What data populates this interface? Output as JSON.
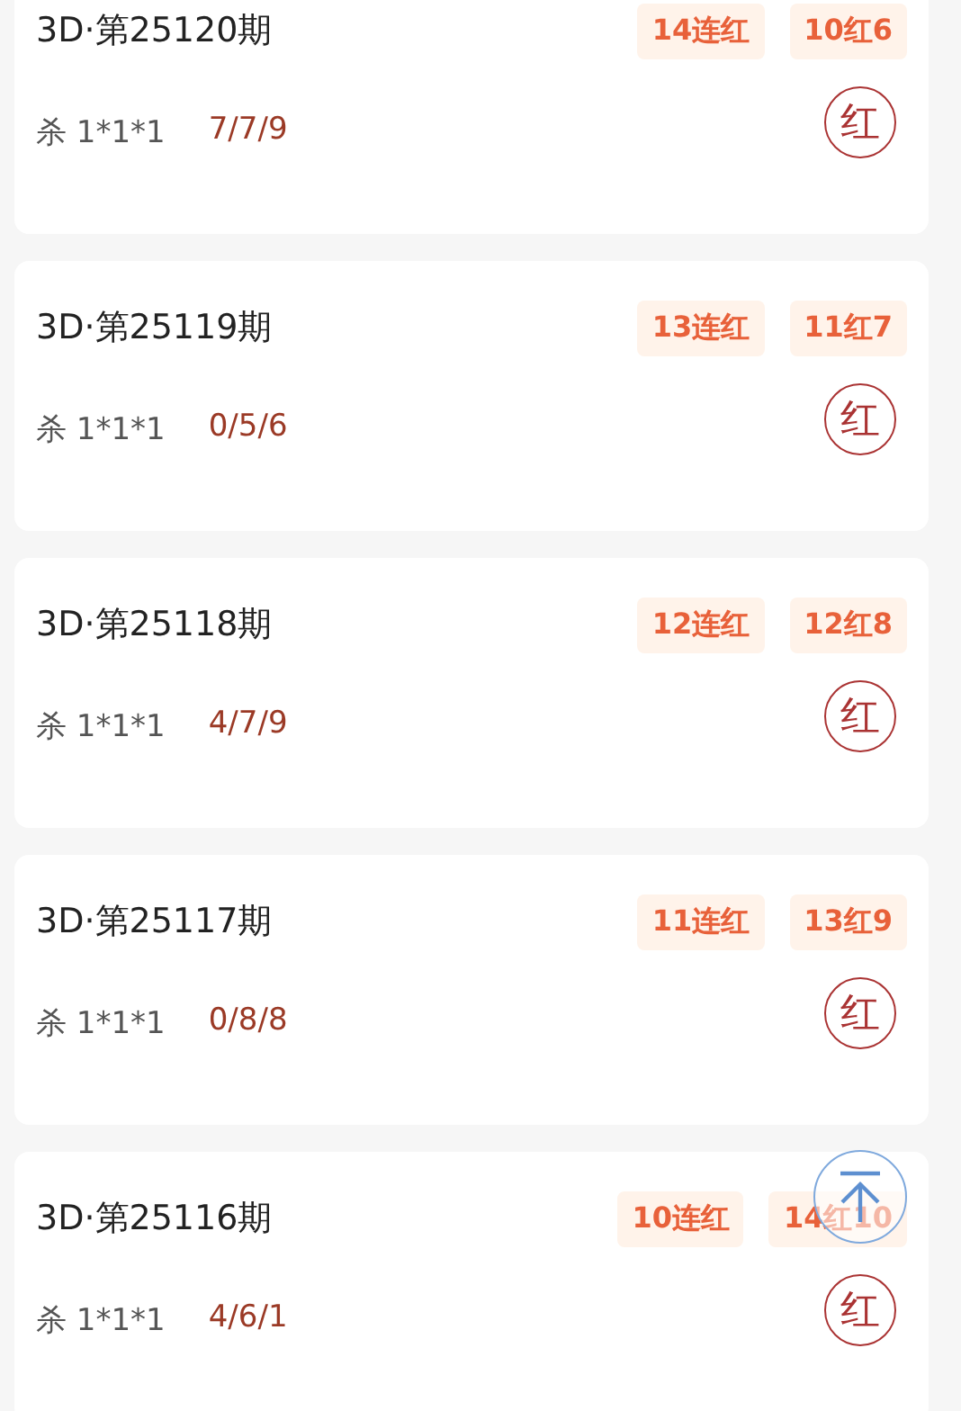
{
  "cards": [
    {
      "title": "3D·第25120期",
      "badges": [
        "14连红",
        "10红6"
      ],
      "kill": "杀 1*1*1",
      "numbers": "7/7/9",
      "result": "红"
    },
    {
      "title": "3D·第25119期",
      "badges": [
        "13连红",
        "11红7"
      ],
      "kill": "杀 1*1*1",
      "numbers": "0/5/6",
      "result": "红"
    },
    {
      "title": "3D·第25118期",
      "badges": [
        "12连红",
        "12红8"
      ],
      "kill": "杀 1*1*1",
      "numbers": "4/7/9",
      "result": "红"
    },
    {
      "title": "3D·第25117期",
      "badges": [
        "11连红",
        "13红9"
      ],
      "kill": "杀 1*1*1",
      "numbers": "0/8/8",
      "result": "红"
    },
    {
      "title": "3D·第25116期",
      "badges": [
        "10连红",
        "14红10"
      ],
      "kill": "杀 1*1*1",
      "numbers": "4/6/1",
      "result": "红"
    }
  ]
}
